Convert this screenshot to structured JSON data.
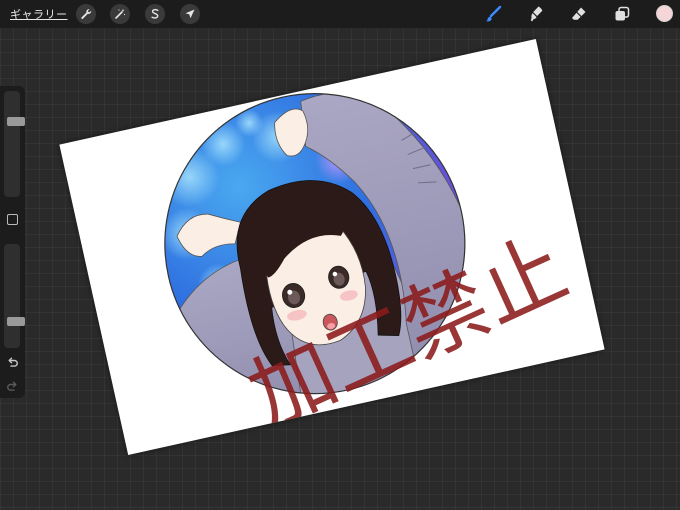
{
  "topbar": {
    "gallery_label": "ギャラリー",
    "actions_icon": "wrench-icon",
    "adjustments_icon": "magic-wand-icon",
    "selection_icon": "selection-s-icon",
    "transform_icon": "arrow-cursor-icon",
    "brush_icon": "brush-icon",
    "smudge_icon": "smudge-icon",
    "eraser_icon": "eraser-icon",
    "layers_icon": "layers-icon",
    "current_color": "#f5d5d8",
    "accent_color": "#3d8bff"
  },
  "sidebar": {
    "brush_size": 0.73,
    "opacity": 0.23,
    "modify_icon": "square-icon",
    "undo_icon": "undo-icon",
    "redo_icon": "redo-icon"
  },
  "canvas": {
    "watermark_text": "加工禁止",
    "watermark_color": "#8b1a1a"
  }
}
